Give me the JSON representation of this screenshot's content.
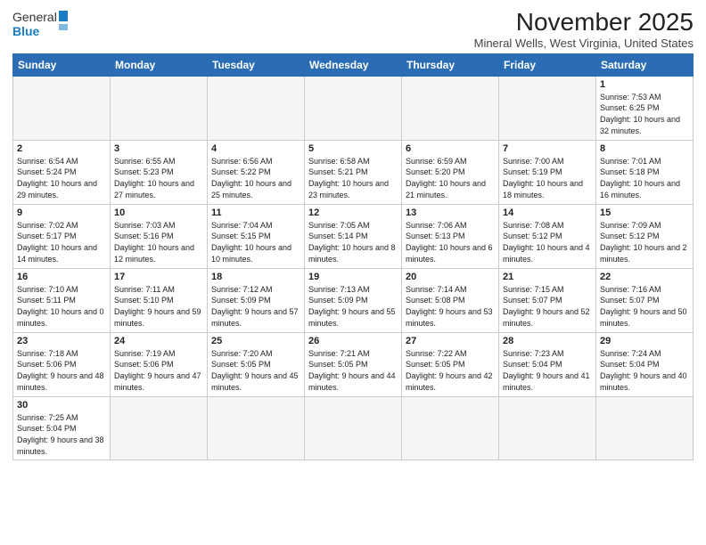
{
  "logo": {
    "text_general": "General",
    "text_blue": "Blue"
  },
  "title": "November 2025",
  "location": "Mineral Wells, West Virginia, United States",
  "weekdays": [
    "Sunday",
    "Monday",
    "Tuesday",
    "Wednesday",
    "Thursday",
    "Friday",
    "Saturday"
  ],
  "weeks": [
    [
      {
        "day": "",
        "info": ""
      },
      {
        "day": "",
        "info": ""
      },
      {
        "day": "",
        "info": ""
      },
      {
        "day": "",
        "info": ""
      },
      {
        "day": "",
        "info": ""
      },
      {
        "day": "",
        "info": ""
      },
      {
        "day": "1",
        "info": "Sunrise: 7:53 AM\nSunset: 6:25 PM\nDaylight: 10 hours and 32 minutes."
      }
    ],
    [
      {
        "day": "2",
        "info": "Sunrise: 6:54 AM\nSunset: 5:24 PM\nDaylight: 10 hours and 29 minutes."
      },
      {
        "day": "3",
        "info": "Sunrise: 6:55 AM\nSunset: 5:23 PM\nDaylight: 10 hours and 27 minutes."
      },
      {
        "day": "4",
        "info": "Sunrise: 6:56 AM\nSunset: 5:22 PM\nDaylight: 10 hours and 25 minutes."
      },
      {
        "day": "5",
        "info": "Sunrise: 6:58 AM\nSunset: 5:21 PM\nDaylight: 10 hours and 23 minutes."
      },
      {
        "day": "6",
        "info": "Sunrise: 6:59 AM\nSunset: 5:20 PM\nDaylight: 10 hours and 21 minutes."
      },
      {
        "day": "7",
        "info": "Sunrise: 7:00 AM\nSunset: 5:19 PM\nDaylight: 10 hours and 18 minutes."
      },
      {
        "day": "8",
        "info": "Sunrise: 7:01 AM\nSunset: 5:18 PM\nDaylight: 10 hours and 16 minutes."
      }
    ],
    [
      {
        "day": "9",
        "info": "Sunrise: 7:02 AM\nSunset: 5:17 PM\nDaylight: 10 hours and 14 minutes."
      },
      {
        "day": "10",
        "info": "Sunrise: 7:03 AM\nSunset: 5:16 PM\nDaylight: 10 hours and 12 minutes."
      },
      {
        "day": "11",
        "info": "Sunrise: 7:04 AM\nSunset: 5:15 PM\nDaylight: 10 hours and 10 minutes."
      },
      {
        "day": "12",
        "info": "Sunrise: 7:05 AM\nSunset: 5:14 PM\nDaylight: 10 hours and 8 minutes."
      },
      {
        "day": "13",
        "info": "Sunrise: 7:06 AM\nSunset: 5:13 PM\nDaylight: 10 hours and 6 minutes."
      },
      {
        "day": "14",
        "info": "Sunrise: 7:08 AM\nSunset: 5:12 PM\nDaylight: 10 hours and 4 minutes."
      },
      {
        "day": "15",
        "info": "Sunrise: 7:09 AM\nSunset: 5:12 PM\nDaylight: 10 hours and 2 minutes."
      }
    ],
    [
      {
        "day": "16",
        "info": "Sunrise: 7:10 AM\nSunset: 5:11 PM\nDaylight: 10 hours and 0 minutes."
      },
      {
        "day": "17",
        "info": "Sunrise: 7:11 AM\nSunset: 5:10 PM\nDaylight: 9 hours and 59 minutes."
      },
      {
        "day": "18",
        "info": "Sunrise: 7:12 AM\nSunset: 5:09 PM\nDaylight: 9 hours and 57 minutes."
      },
      {
        "day": "19",
        "info": "Sunrise: 7:13 AM\nSunset: 5:09 PM\nDaylight: 9 hours and 55 minutes."
      },
      {
        "day": "20",
        "info": "Sunrise: 7:14 AM\nSunset: 5:08 PM\nDaylight: 9 hours and 53 minutes."
      },
      {
        "day": "21",
        "info": "Sunrise: 7:15 AM\nSunset: 5:07 PM\nDaylight: 9 hours and 52 minutes."
      },
      {
        "day": "22",
        "info": "Sunrise: 7:16 AM\nSunset: 5:07 PM\nDaylight: 9 hours and 50 minutes."
      }
    ],
    [
      {
        "day": "23",
        "info": "Sunrise: 7:18 AM\nSunset: 5:06 PM\nDaylight: 9 hours and 48 minutes."
      },
      {
        "day": "24",
        "info": "Sunrise: 7:19 AM\nSunset: 5:06 PM\nDaylight: 9 hours and 47 minutes."
      },
      {
        "day": "25",
        "info": "Sunrise: 7:20 AM\nSunset: 5:05 PM\nDaylight: 9 hours and 45 minutes."
      },
      {
        "day": "26",
        "info": "Sunrise: 7:21 AM\nSunset: 5:05 PM\nDaylight: 9 hours and 44 minutes."
      },
      {
        "day": "27",
        "info": "Sunrise: 7:22 AM\nSunset: 5:05 PM\nDaylight: 9 hours and 42 minutes."
      },
      {
        "day": "28",
        "info": "Sunrise: 7:23 AM\nSunset: 5:04 PM\nDaylight: 9 hours and 41 minutes."
      },
      {
        "day": "29",
        "info": "Sunrise: 7:24 AM\nSunset: 5:04 PM\nDaylight: 9 hours and 40 minutes."
      }
    ],
    [
      {
        "day": "30",
        "info": "Sunrise: 7:25 AM\nSunset: 5:04 PM\nDaylight: 9 hours and 38 minutes."
      },
      {
        "day": "",
        "info": ""
      },
      {
        "day": "",
        "info": ""
      },
      {
        "day": "",
        "info": ""
      },
      {
        "day": "",
        "info": ""
      },
      {
        "day": "",
        "info": ""
      },
      {
        "day": "",
        "info": ""
      }
    ]
  ]
}
